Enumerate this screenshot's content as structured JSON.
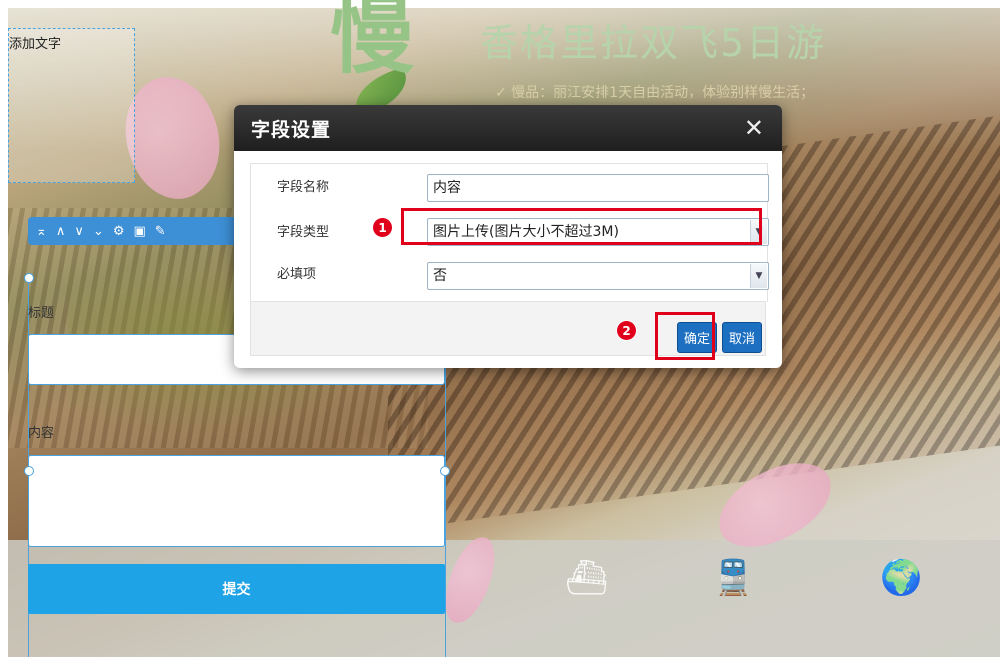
{
  "background": {
    "banner_char": "慢",
    "banner_title": "香格里拉双飞5日游",
    "banner_sub": "✓ 慢品：丽江安排1天自由活动，体验别样慢生活；",
    "strip_icons": [
      "ship-icon",
      "train-icon",
      "globe-icon"
    ]
  },
  "editor": {
    "text_box_label": "添加文字",
    "toolbar_icons": [
      "⌅",
      "∧",
      "∨",
      "⌄",
      "⚙",
      "▣",
      "✎"
    ],
    "title_label": "标题",
    "content_label": "内容",
    "submit_label": "提交"
  },
  "modal": {
    "title": "字段设置",
    "close": "✕",
    "rows": [
      {
        "label": "字段名称",
        "value": "内容"
      },
      {
        "label": "字段类型",
        "value": "图片上传(图片大小不超过3M)"
      },
      {
        "label": "必填项",
        "value": "否"
      }
    ],
    "ok_label": "确定",
    "cancel_label": "取消"
  },
  "annotations": {
    "step1": "1",
    "step2": "2",
    "highlight_color": "#e0001b"
  }
}
